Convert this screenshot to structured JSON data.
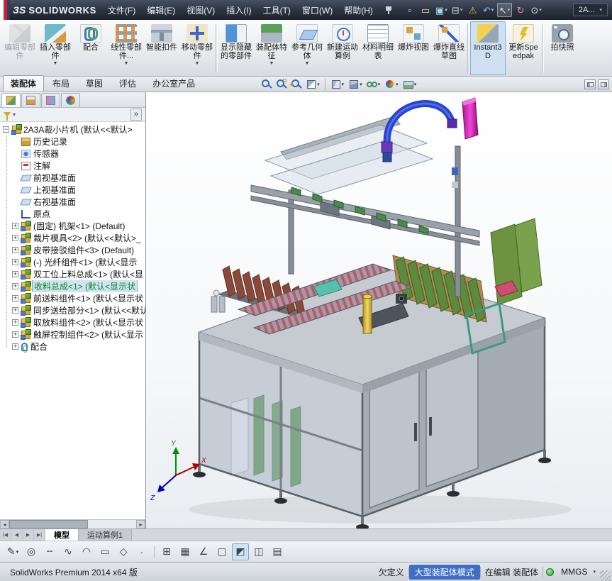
{
  "titlebar": {
    "brand_mark": "ЗS",
    "brand": "SOLIDWORKS",
    "menus": [
      "文件(F)",
      "编辑(E)",
      "视图(V)",
      "插入(I)",
      "工具(T)",
      "窗口(W)",
      "帮助(H)"
    ],
    "quick_tools": [
      {
        "name": "new-document-icon",
        "glyph": "▫"
      },
      {
        "name": "open-icon",
        "glyph": "▭"
      },
      {
        "name": "save-icon",
        "glyph": "▣",
        "dropdown": true
      },
      {
        "name": "print-icon",
        "glyph": "⊟",
        "dropdown": true
      },
      {
        "name": "errors-icon",
        "glyph": "⚠"
      },
      {
        "name": "undo-icon",
        "glyph": "↶",
        "dropdown": true
      },
      {
        "name": "select-icon",
        "glyph": "↖",
        "dropdown": true,
        "active": true
      },
      {
        "name": "rebuild-icon",
        "glyph": "↻"
      },
      {
        "name": "options-icon",
        "glyph": "⊙",
        "dropdown": true
      }
    ],
    "search_value": "2A..."
  },
  "ribbon": {
    "buttons": [
      {
        "label": "编辑零部件",
        "icon": "edit-component",
        "disabled": true
      },
      {
        "label": "插入零部件",
        "icon": "insert-component",
        "dropdown": true
      },
      {
        "label": "配合",
        "icon": "mate"
      },
      {
        "label": "线性零部件...",
        "icon": "linear-component-pattern",
        "dropdown": true
      },
      {
        "label": "智能扣件",
        "icon": "smart-fasteners"
      },
      {
        "label": "移动零部件",
        "icon": "move-component",
        "dropdown": true
      },
      {
        "sep": true
      },
      {
        "label": "显示隐藏的零部件",
        "icon": "show-hidden-components"
      },
      {
        "label": "装配体特征",
        "icon": "assembly-features",
        "dropdown": true
      },
      {
        "label": "参考几何体",
        "icon": "reference-geometry",
        "dropdown": true
      },
      {
        "label": "新建运动算例",
        "icon": "new-motion-study"
      },
      {
        "label": "材料明细表",
        "icon": "bill-of-materials"
      },
      {
        "label": "爆炸视图",
        "icon": "exploded-view"
      },
      {
        "label": "爆炸直线草图",
        "icon": "explode-line-sketch"
      },
      {
        "sep": true
      },
      {
        "label": "Instant3D",
        "icon": "instant3d",
        "active": true
      },
      {
        "label": "更新Speedpak",
        "icon": "update-speedpak"
      },
      {
        "sep": true
      },
      {
        "label": "拍快照",
        "icon": "take-snapshot"
      }
    ]
  },
  "tabs": [
    {
      "label": "装配体",
      "active": true
    },
    {
      "label": "布局"
    },
    {
      "label": "草图"
    },
    {
      "label": "评估"
    },
    {
      "label": "办公室产品"
    }
  ],
  "hud": [
    {
      "name": "zoom-to-fit-button"
    },
    {
      "name": "zoom-to-area-button"
    },
    {
      "name": "previous-view-button"
    },
    {
      "name": "section-view-button",
      "dropdown": true
    },
    {
      "sep": true
    },
    {
      "name": "view-orientation-button",
      "dropdown": true
    },
    {
      "name": "display-style-button",
      "dropdown": true
    },
    {
      "name": "hide-show-items-button",
      "dropdown": true
    },
    {
      "name": "edit-appearance-button",
      "dropdown": true
    },
    {
      "name": "apply-scene-button",
      "dropdown": true
    }
  ],
  "sidebar": {
    "manager_tabs": [
      {
        "name": "feature-manager-tab",
        "active": true
      },
      {
        "name": "property-manager-tab"
      },
      {
        "name": "configuration-manager-tab"
      },
      {
        "name": "display-manager-tab"
      }
    ],
    "flyout_glyph": "»"
  },
  "tree": {
    "root": {
      "label": "2A3A裁小片机 (默认<<默认>",
      "warn": true
    },
    "items": [
      {
        "icon": "history",
        "label": "历史记录"
      },
      {
        "icon": "sensor",
        "label": "传感器"
      },
      {
        "icon": "annotation",
        "label": "注解"
      },
      {
        "icon": "plane",
        "label": "前视基准面"
      },
      {
        "icon": "plane",
        "label": "上视基准面"
      },
      {
        "icon": "plane",
        "label": "右视基准面"
      },
      {
        "icon": "origin",
        "label": "原点"
      },
      {
        "icon": "assembly",
        "expand": true,
        "label": "(固定) 机架<1> (Default)"
      },
      {
        "icon": "assembly",
        "expand": true,
        "label": "裁片模具<2> (默认<<默认>_"
      },
      {
        "icon": "assembly",
        "expand": true,
        "label": "皮带接驳组件<3> (Default)"
      },
      {
        "icon": "assembly",
        "expand": true,
        "label": "(-) 光纤组件<1> (默认<显示"
      },
      {
        "icon": "assembly",
        "expand": true,
        "label": "双工位上料总成<1> (默认<显"
      },
      {
        "icon": "assembly",
        "expand": true,
        "warn": true,
        "selected": true,
        "label": "收料总成<1> (默认<显示状"
      },
      {
        "icon": "assembly",
        "expand": true,
        "label": "前送料组件<1> (默认<显示状"
      },
      {
        "icon": "assembly",
        "expand": true,
        "label": "同步送给部分<1> (默认<<默认"
      },
      {
        "icon": "assembly",
        "expand": true,
        "label": "取放料组件<2> (默认<显示状"
      },
      {
        "icon": "assembly",
        "expand": true,
        "label": "触屏控制组件<2> (默认<显示"
      },
      {
        "icon": "mates",
        "expand": true,
        "label": "配合"
      }
    ]
  },
  "viewport": {
    "triad": {
      "x": "X",
      "y": "Y",
      "z": "Z"
    }
  },
  "model_tabs": {
    "nav": [
      {
        "name": "first-tab-button",
        "glyph": "|◀"
      },
      {
        "name": "previous-tab-button",
        "glyph": "◀"
      },
      {
        "name": "next-tab-button",
        "glyph": "▶"
      },
      {
        "name": "last-tab-button",
        "glyph": "▶|"
      }
    ],
    "tabs": [
      {
        "label": "模型",
        "active": true
      },
      {
        "label": "运动算例1"
      }
    ]
  },
  "sketch_tools": [
    {
      "name": "sketch-tool",
      "glyph": "✎",
      "dropdown": true
    },
    {
      "name": "circle-tool",
      "glyph": "◎"
    },
    {
      "name": "centerline-tool",
      "glyph": "╌"
    },
    {
      "name": "spline-tool",
      "glyph": "∿"
    },
    {
      "name": "arc-tool",
      "glyph": "◠"
    },
    {
      "name": "rectangle-tool",
      "glyph": "▭"
    },
    {
      "name": "polygon-tool",
      "glyph": "◇"
    },
    {
      "name": "point-tool",
      "glyph": "·"
    },
    {
      "sep": true
    },
    {
      "name": "linear-pattern-tool",
      "glyph": "⊞"
    },
    {
      "name": "grid-tool",
      "glyph": "▦"
    },
    {
      "name": "angle-tool",
      "glyph": "∠"
    },
    {
      "name": "wireframe-cube-tool",
      "glyph": "▢"
    },
    {
      "name": "shaded-cube-tool",
      "glyph": "◩",
      "active": true
    },
    {
      "name": "section-cube-tool",
      "glyph": "◫"
    },
    {
      "name": "grid-system-tool",
      "glyph": "▤"
    }
  ],
  "statusbar": {
    "left": "SolidWorks Premium 2014 x64 版",
    "constraint_status": "欠定义",
    "assembly_mode": "大型装配体模式",
    "editing_status": "在编辑 装配体",
    "units": "MMGS"
  },
  "colors": {
    "titlebar": "#2b3342",
    "assembly_mode_badge": "#3d6fc4",
    "selected_component_text": "#138a13",
    "warning": "#e8a000",
    "viewport_background": "#f5f7f9"
  }
}
